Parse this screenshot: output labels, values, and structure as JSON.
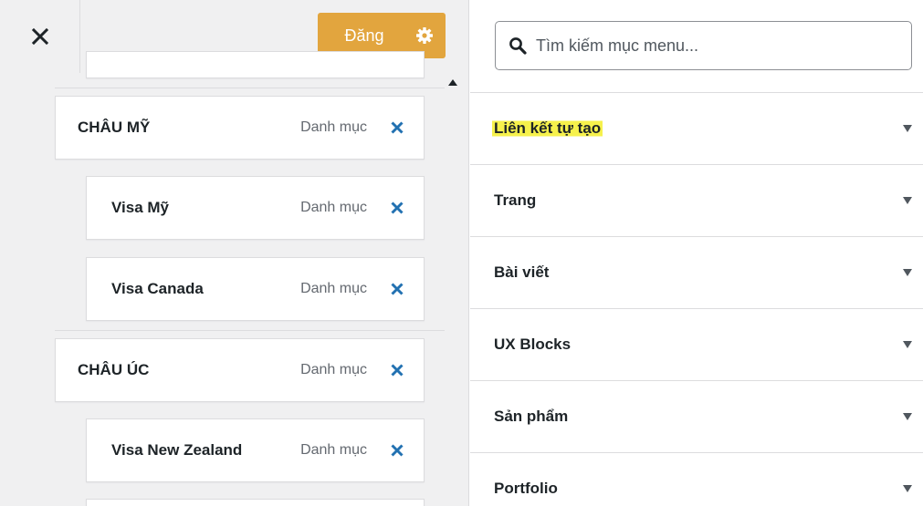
{
  "toolbar": {
    "close_icon": "close-icon",
    "publish_label": "Đăng",
    "settings_icon": "gear-icon",
    "accent_color": "#e2a53e"
  },
  "menu_items": [
    {
      "title": "CHÂU MỸ",
      "type": "Danh mục",
      "level": 0
    },
    {
      "title": "Visa Mỹ",
      "type": "Danh mục",
      "level": 1
    },
    {
      "title": "Visa Canada",
      "type": "Danh mục",
      "level": 1
    },
    {
      "title": "CHÂU ÚC",
      "type": "Danh mục",
      "level": 0
    },
    {
      "title": "Visa New Zealand",
      "type": "Danh mục",
      "level": 1
    }
  ],
  "search": {
    "placeholder": "Tìm kiếm mục menu...",
    "value": ""
  },
  "sections": [
    {
      "label": "Liên kết tự tạo",
      "highlighted": true
    },
    {
      "label": "Trang"
    },
    {
      "label": "Bài viết"
    },
    {
      "label": "UX Blocks"
    },
    {
      "label": "Sản phẩm"
    },
    {
      "label": "Portfolio"
    }
  ],
  "colors": {
    "highlight": "#f6f14c",
    "remove_icon": "#2271b1"
  }
}
